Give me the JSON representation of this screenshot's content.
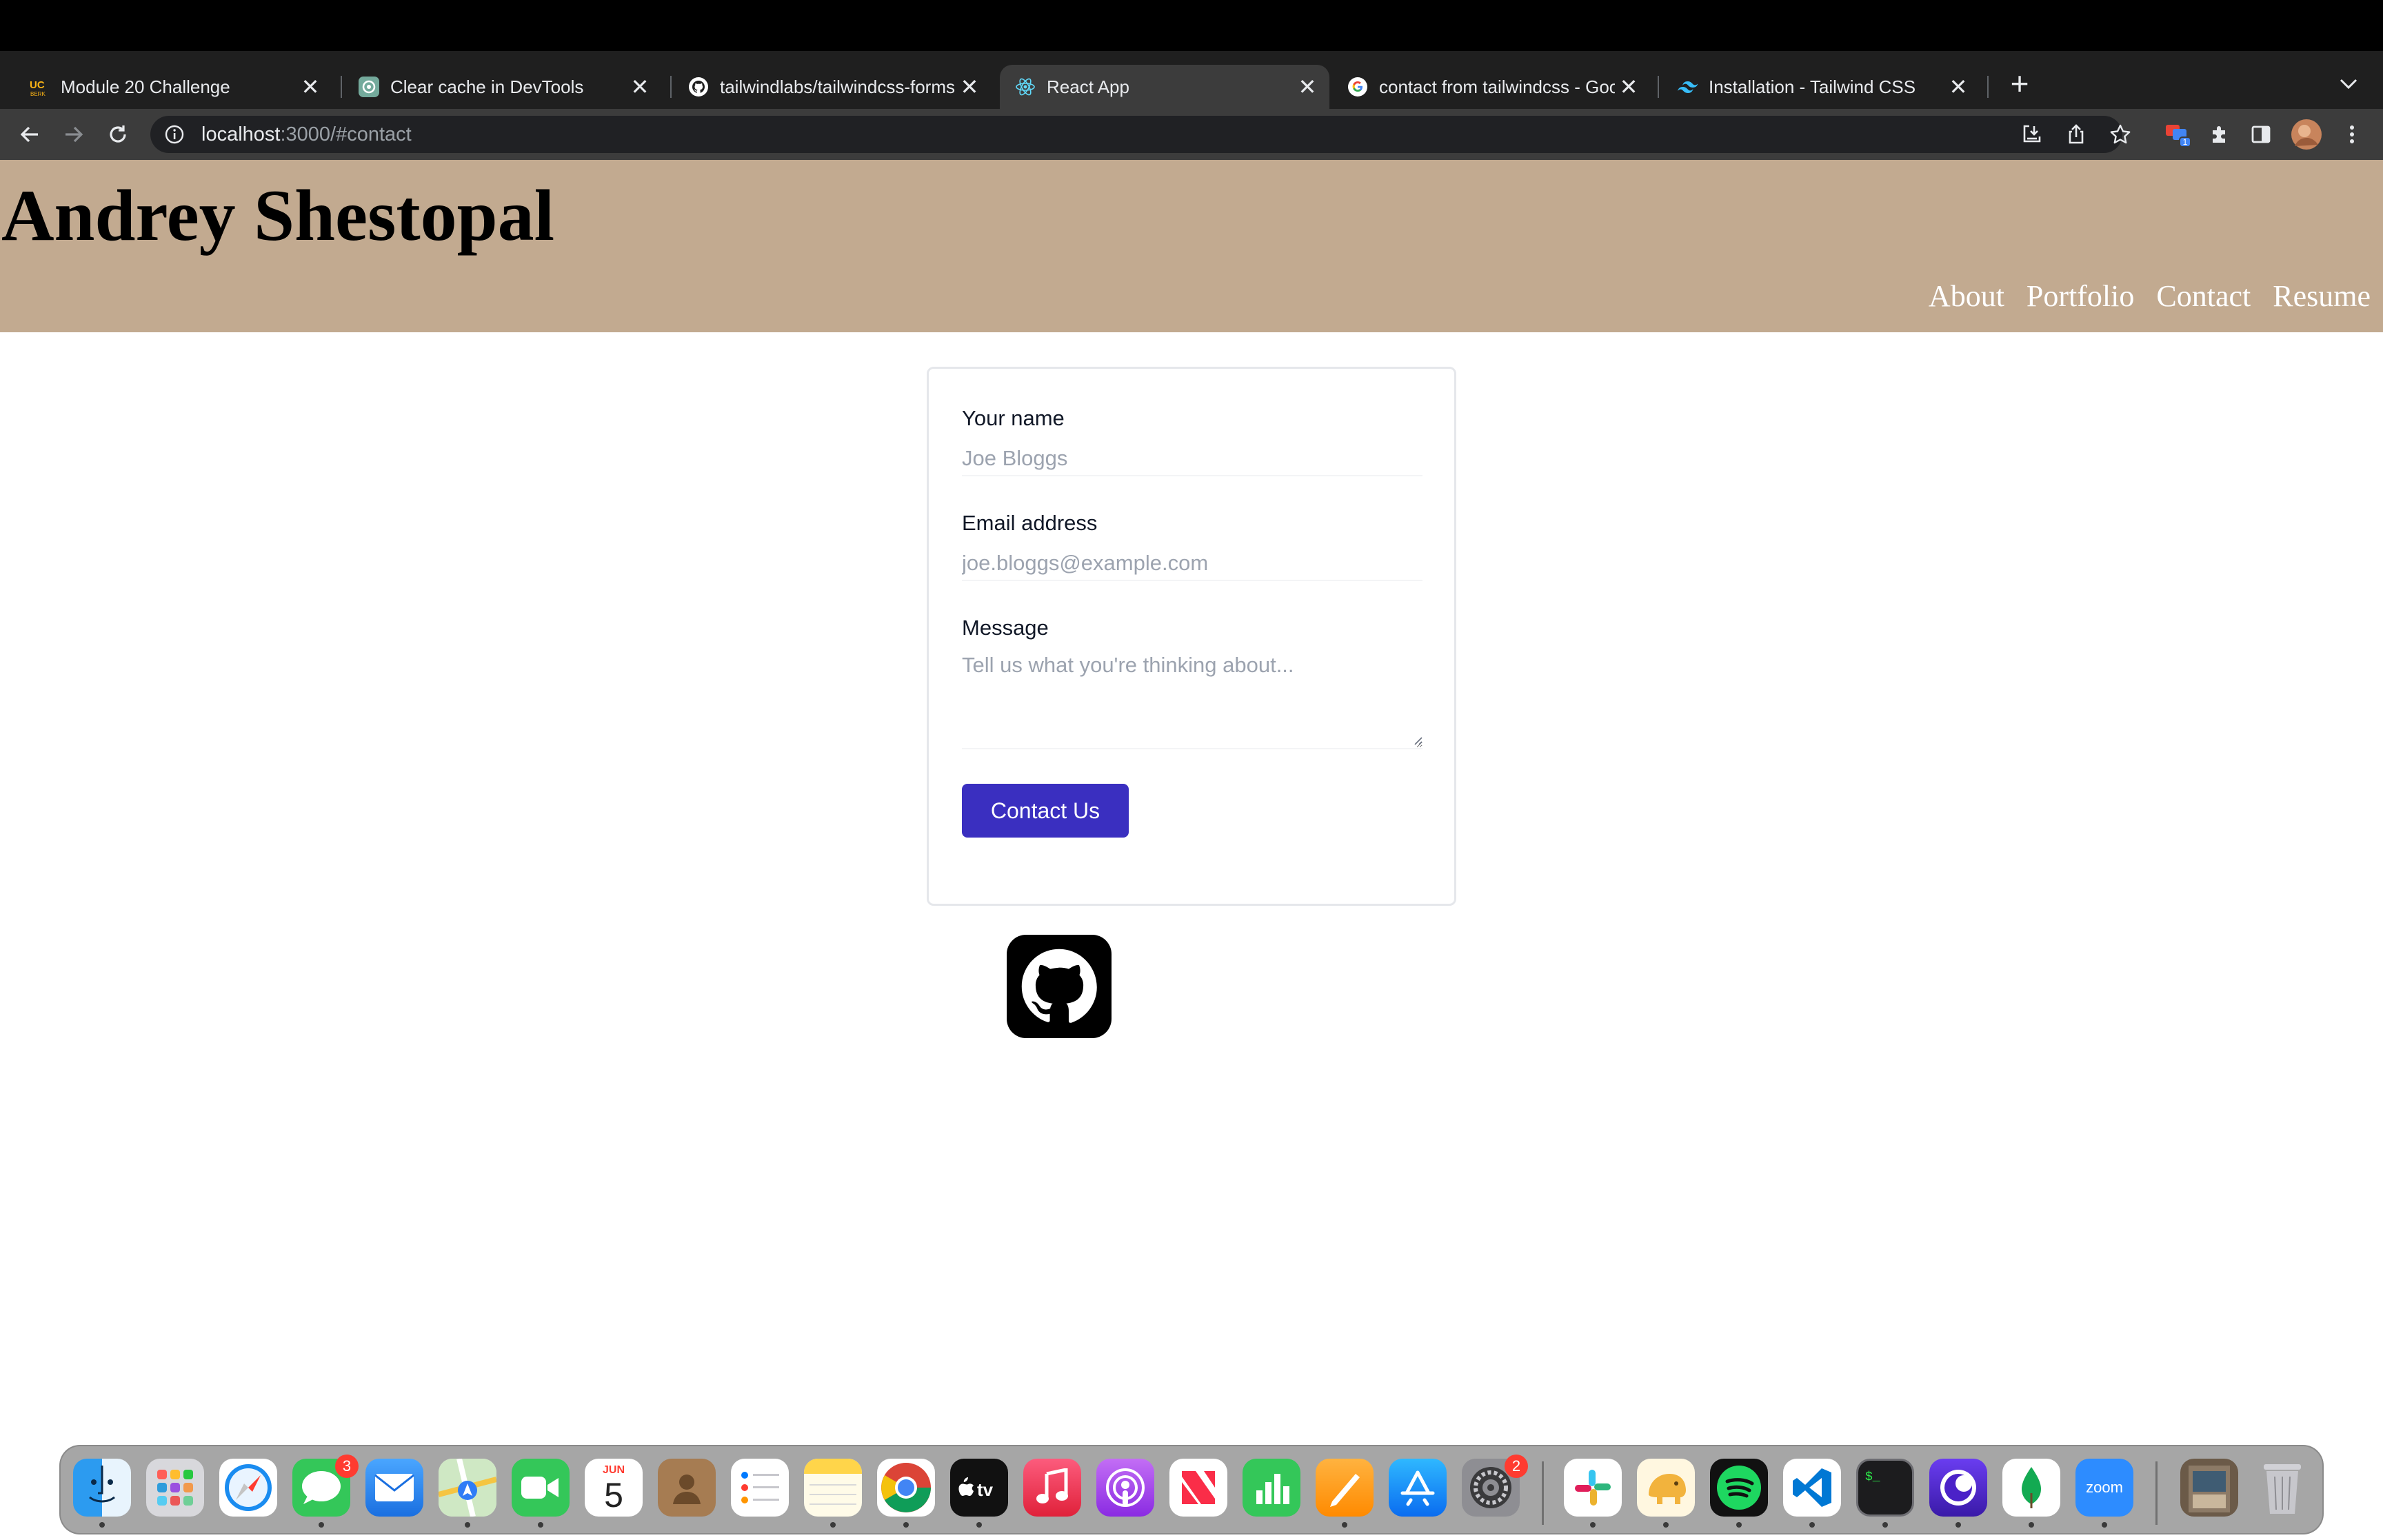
{
  "browser": {
    "tabs": [
      {
        "title": "Module 20 Challenge",
        "favicon": "uc-berkeley-logo-icon",
        "active": false
      },
      {
        "title": "Clear cache in DevTools",
        "favicon": "chatgpt-icon",
        "active": false
      },
      {
        "title": "tailwindlabs/tailwindcss-forms",
        "favicon": "github-icon",
        "active": false
      },
      {
        "title": "React App",
        "favicon": "react-icon",
        "active": true
      },
      {
        "title": "contact from tailwindcss - Goo",
        "favicon": "google-icon",
        "active": false
      },
      {
        "title": "Installation - Tailwind CSS",
        "favicon": "tailwind-icon",
        "active": false
      }
    ],
    "address": {
      "host": "localhost",
      "path": ":3000/#contact"
    },
    "extension_badge": "1"
  },
  "site": {
    "title": "Andrey Shestopal",
    "nav": [
      "About",
      "Portfolio",
      "Contact",
      "Resume"
    ],
    "colors": {
      "header_bg": "#c2aa90",
      "button_bg": "#3a2fc0"
    }
  },
  "contact_form": {
    "name_label": "Your name",
    "name_placeholder": "Joe Bloggs",
    "email_label": "Email address",
    "email_placeholder": "joe.bloggs@example.com",
    "message_label": "Message",
    "message_placeholder": "Tell us what you're thinking about...",
    "submit_label": "Contact Us"
  },
  "social": {
    "github": "github-icon"
  },
  "dock": {
    "calendar_month": "JUN",
    "calendar_day": "5",
    "messages_badge": "3",
    "settings_badge": "2",
    "zoom_label": "zoom"
  }
}
